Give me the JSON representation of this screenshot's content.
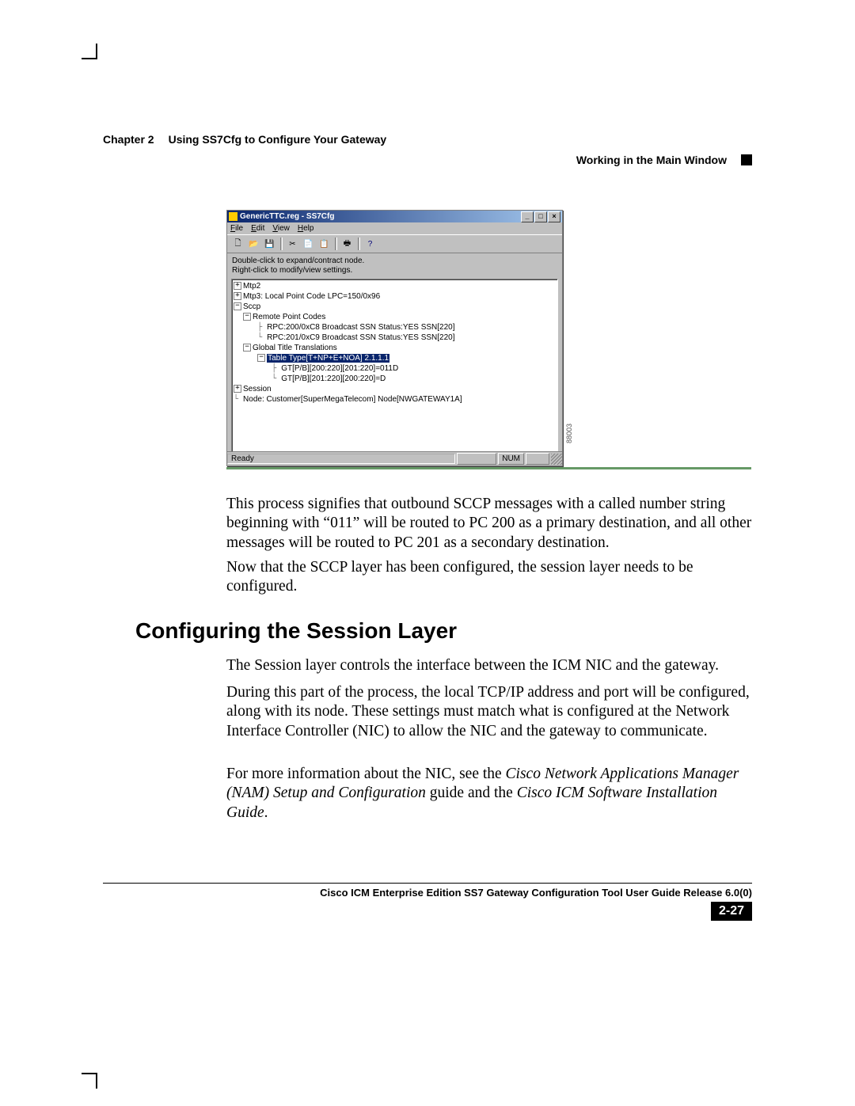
{
  "header": {
    "chapter": "Chapter 2",
    "chapter_title": "Using SS7Cfg to Configure Your Gateway",
    "section": "Working in the Main Window"
  },
  "screenshot": {
    "title": "GenericTTC.reg - SS7Cfg",
    "menus": {
      "file": "File",
      "edit": "Edit",
      "view": "View",
      "help": "Help"
    },
    "hint1": "Double-click to expand/contract node.",
    "hint2": "Right-click to modify/view settings.",
    "tree": {
      "mtp2": "Mtp2",
      "mtp3": "Mtp3: Local Point Code LPC=150/0x96",
      "sccp": "Sccp",
      "rpc_hdr": "Remote Point Codes",
      "rpc1": "RPC:200/0xC8 Broadcast SSN Status:YES  SSN[220]",
      "rpc2": "RPC:201/0xC9 Broadcast SSN Status:YES  SSN[220]",
      "gtt_hdr": "Global Title Translations",
      "gtt_sel": "Table Type[T+NP+E+NOA] 2.1.1.1",
      "gt1": "GT[P/B][200:220][201:220]=011D",
      "gt2": "GT[P/B][201:220][200:220]=D",
      "session": "Session",
      "node": "Node:  Customer[SuperMegaTelecom] Node[NWGATEWAY1A]"
    },
    "status": {
      "ready": "Ready",
      "num": "NUM"
    },
    "fig_id": "88003"
  },
  "body": {
    "p1": "This process signifies that outbound SCCP messages with a called number string beginning with “011” will be routed to PC 200 as a primary destination, and all other messages will be routed to PC 201 as a secondary destination.",
    "p2": "Now that the SCCP layer has been configured, the session layer needs to be configured.",
    "heading": "Configuring the Session Layer",
    "p3": "The Session layer controls the interface between the ICM NIC and the gateway.",
    "p4": "During this part of the process, the local TCP/IP address and port will be configured, along with its node. These settings must match what is configured at the Network Interface Controller (NIC) to allow the NIC and the gateway to communicate.",
    "p5a": "For more information about the NIC, see the ",
    "p5b": "Cisco Network Applications Manager (NAM) Setup and Configuration",
    "p5c": " guide and the ",
    "p5d": "Cisco ICM Software Installation Guide",
    "p5e": "."
  },
  "footer": {
    "book": "Cisco ICM Enterprise Edition SS7 Gateway Configuration Tool User Guide Release 6.0(0)",
    "page": "2-27"
  }
}
